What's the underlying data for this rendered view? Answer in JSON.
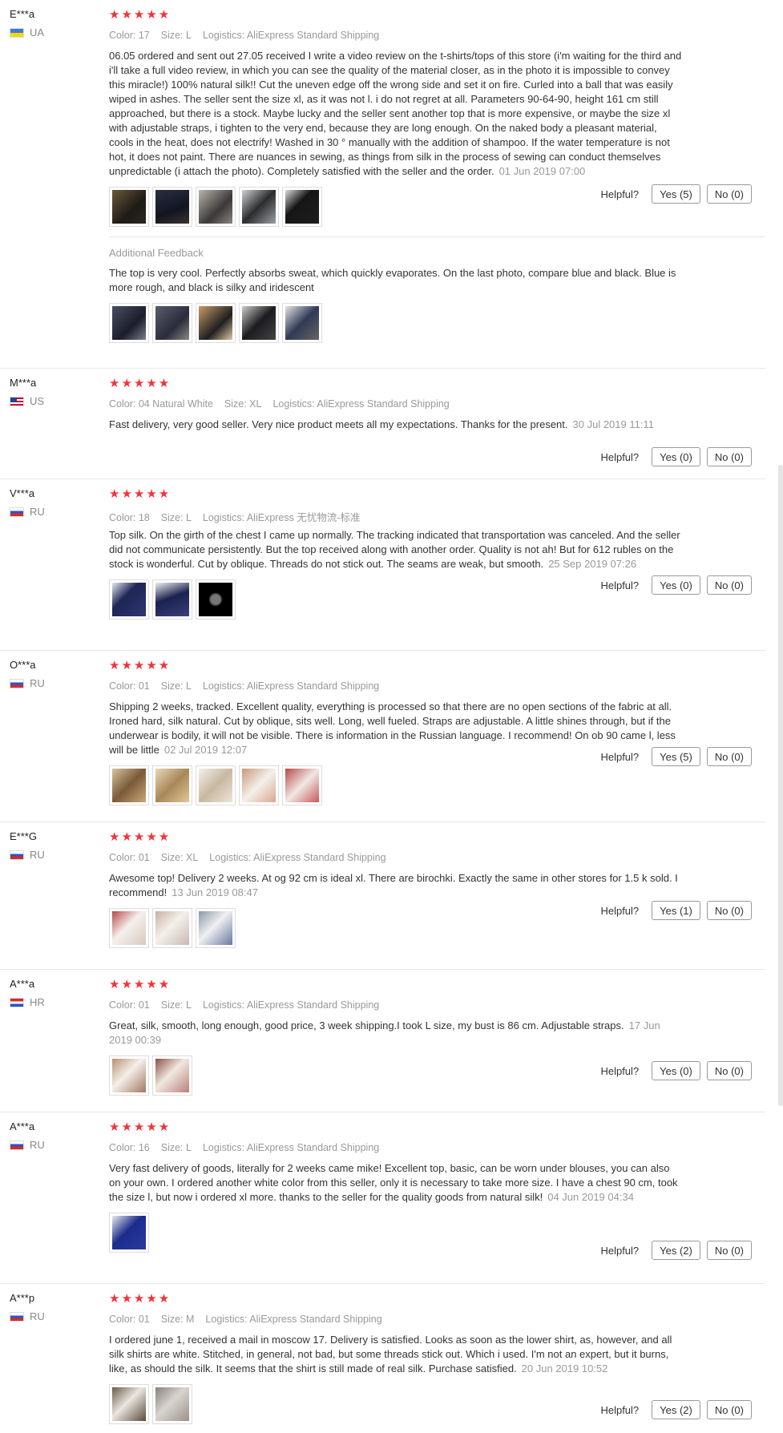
{
  "helpful_label": "Helpful?",
  "additional_feedback_label": "Additional Feedback",
  "reviews": [
    {
      "name": "E***a",
      "country": "UA",
      "rating": "★★★★★",
      "color": "Color: 17",
      "size": "Size: L",
      "logistics": "Logistics: AliExpress Standard Shipping",
      "text": "06.05 ordered and sent out 27.05 received I write a video review on the t-shirts/tops of this store (i'm waiting for the third and i'll take a full video review, in which you can see the quality of the material closer, as in the photo it is impossible to convey this miracle!) 100% natural silk!! Cut the uneven edge off the wrong side and set it on fire. Curled into a ball that was easily wiped in ashes. The seller sent the size xl, as it was not l. i do not regret at all. Parameters 90-64-90, height 161 cm still approached, but there is a stock. Maybe lucky and the seller sent another top that is more expensive, or maybe the size xl with adjustable straps, i tighten to the very end, because they are long enough. On the naked body a pleasant material, cools in the heat, does not electrify! Washed in 30 ° manually with the addition of shampoo. If the water temperature is not hot, it does not paint. There are nuances in sewing, as things from silk in the process of sewing can conduct themselves unpredictable (i attach the photo). Completely satisfied with the seller and the order.",
      "date": "01 Jun 2019 07:00",
      "yes": "Yes (5)",
      "no": "No (0)",
      "additional": "The top is very cool. Perfectly absorbs sweat, which quickly evaporates. On the last photo, compare blue and black. Blue is more rough, and black is silky and iridescent"
    },
    {
      "name": "M***a",
      "country": "US",
      "rating": "★★★★★",
      "color": "Color: 04 Natural White",
      "size": "Size: XL",
      "logistics": "Logistics: AliExpress Standard Shipping",
      "text": "Fast delivery, very good seller. Very nice product meets all my expectations. Thanks for the present.",
      "date": "30 Jul 2019 11:11",
      "yes": "Yes (0)",
      "no": "No (0)"
    },
    {
      "name": "V***a",
      "country": "RU",
      "rating": "★★★★★",
      "color": "Color: 18",
      "size": "Size: L",
      "logistics": "Logistics: AliExpress 无忧物流-标准",
      "text": "Top silk. On the girth of the chest I came up normally. The tracking indicated that transportation was canceled. And the seller did not communicate persistently. But the top received along with another order. Quality is not ah! But for 612 rubles on the stock is wonderful. Cut by oblique. Threads do not stick out. The seams are weak, but smooth.",
      "date": "25 Sep 2019 07:26",
      "yes": "Yes (0)",
      "no": "No (0)"
    },
    {
      "name": "O***a",
      "country": "RU",
      "rating": "★★★★★",
      "color": "Color: 01",
      "size": "Size: L",
      "logistics": "Logistics: AliExpress Standard Shipping",
      "text": "Shipping 2 weeks, tracked. Excellent quality, everything is processed so that there are no open sections of the fabric at all. Ironed hard, silk natural. Cut by oblique, sits well. Long, well fueled. Straps are adjustable. A little shines through, but if the underwear is bodily, it will not be visible. There is information in the Russian language. I recommend! On ob 90 came l, less will be little",
      "date": "02 Jul 2019 12:07",
      "yes": "Yes (5)",
      "no": "No (0)"
    },
    {
      "name": "E***G",
      "country": "RU",
      "rating": "★★★★★",
      "color": "Color: 01",
      "size": "Size: XL",
      "logistics": "Logistics: AliExpress Standard Shipping",
      "text": "Awesome top! Delivery 2 weeks. At og 92 cm is ideal xl. There are birochki. Exactly the same in other stores for 1.5 k sold. I recommend!",
      "date": "13 Jun 2019 08:47",
      "yes": "Yes (1)",
      "no": "No (0)"
    },
    {
      "name": "A***a",
      "country": "HR",
      "rating": "★★★★★",
      "color": "Color: 01",
      "size": "Size: L",
      "logistics": "Logistics: AliExpress Standard Shipping",
      "text": "Great, silk, smooth, long enough, good price, 3 week shipping.I took L size, my bust is 86 cm. Adjustable straps.",
      "date": "17 Jun 2019 00:39",
      "yes": "Yes (0)",
      "no": "No (0)"
    },
    {
      "name": "A***a",
      "country": "RU",
      "rating": "★★★★★",
      "color": "Color: 16",
      "size": "Size: L",
      "logistics": "Logistics: AliExpress Standard Shipping",
      "text": "Very fast delivery of goods, literally for 2 weeks came mike! Excellent top, basic, can be worn under blouses, you can also on your own. I ordered another white color from this seller, only it is necessary to take more size. I have a chest 90 cm, took the size l, but now i ordered xl more. thanks to the seller for the quality goods from natural silk!",
      "date": "04 Jun 2019 04:34",
      "yes": "Yes (2)",
      "no": "No (0)"
    },
    {
      "name": "A***p",
      "country": "RU",
      "rating": "★★★★★",
      "color": "Color: 01",
      "size": "Size: M",
      "logistics": "Logistics: AliExpress Standard Shipping",
      "text": "I ordered june 1, received a mail in moscow 17. Delivery is satisfied. Looks as soon as the lower shirt, as, however, and all silk shirts are white. Stitched, in general, not bad, but some threads stick out. Which i used. I'm not an expert, but it burns, like, as should the silk. It seems that the shirt is still made of real silk. Purchase satisfied.",
      "date": "20 Jun 2019 10:52",
      "yes": "Yes (2)",
      "no": "No (0)"
    }
  ]
}
